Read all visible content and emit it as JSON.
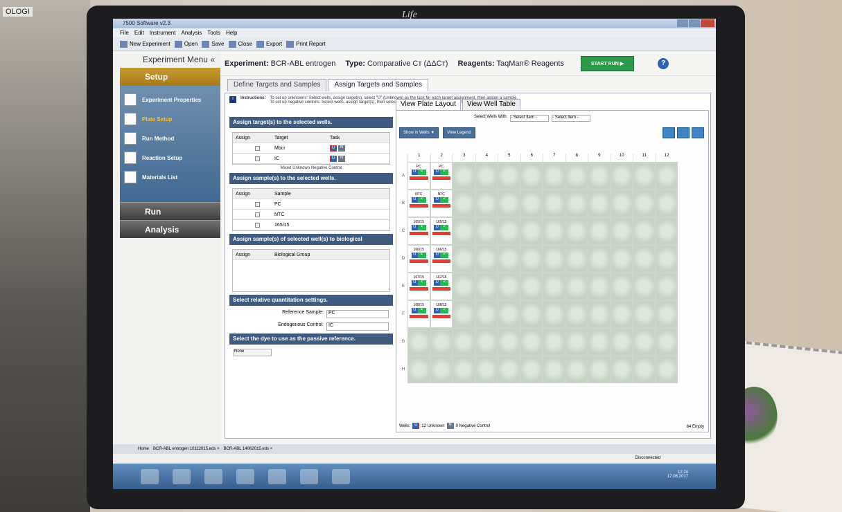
{
  "window": {
    "title": "7500 Software v2.3"
  },
  "menu": [
    "File",
    "Edit",
    "Instrument",
    "Analysis",
    "Tools",
    "Help"
  ],
  "toolbar": [
    "New Experiment",
    "Open",
    "Save",
    "Close",
    "Export",
    "Print Report"
  ],
  "sidebar": {
    "title": "Experiment Menu «",
    "setup": "Setup",
    "items": [
      "Experiment Properties",
      "Plate Setup",
      "Run Method",
      "Reaction Setup",
      "Materials List"
    ],
    "run": "Run",
    "analysis": "Analysis"
  },
  "experiment": {
    "label": "Experiment:",
    "name": "BCR-ABL entrogen",
    "type_label": "Type:",
    "type": "Comparative Cт (ΔΔCт)",
    "reagents_label": "Reagents:",
    "reagents": "TaqMan® Reagents",
    "start_run": "START RUN ▶",
    "help": "?"
  },
  "tabs": [
    "Define Targets and Samples",
    "Assign Targets and Samples"
  ],
  "instructions": {
    "label": "Instructions:",
    "line1": "To set up unknowns: Select wells, assign target(s), select \"U\" (Unknown) as the task for each target assignment, then assign a sample.",
    "line2": "To set up negative controls: Select wells, assign target(s), then select \"N\" (Negative Control) as the task for each target assignment."
  },
  "assign_targets": {
    "header": "Assign target(s) to the selected wells.",
    "columns": [
      "Assign",
      "Target",
      "Task"
    ],
    "rows": [
      {
        "target": "Mbcr"
      },
      {
        "target": "IC"
      }
    ],
    "legend": "Mixed  Unknown  Negative Control"
  },
  "assign_samples": {
    "header": "Assign sample(s) to the selected wells.",
    "columns": [
      "Assign",
      "Sample"
    ],
    "rows": [
      "PC",
      "NTC",
      "165/15"
    ]
  },
  "bio_groups": {
    "header": "Assign sample(s) of selected well(s) to biological",
    "columns": [
      "Assign",
      "Biological Group"
    ]
  },
  "rq": {
    "header": "Select relative quantitation settings.",
    "ref_label": "Reference Sample:",
    "ref_value": "PC",
    "endo_label": "Endogenous Control:",
    "endo_value": "IC"
  },
  "dye": {
    "header": "Select the dye to use as the passive reference.",
    "value": "None"
  },
  "plate_tabs": [
    "View Plate Layout",
    "View Well Table"
  ],
  "select_wells": {
    "label": "Select Wells With:",
    "opt1": "- Select Item -",
    "opt2": "- Select Item -"
  },
  "plate_buttons": {
    "show": "Show in Wells ▼",
    "legend": "View Legend"
  },
  "columns": [
    "1",
    "2",
    "3",
    "4",
    "5",
    "6",
    "7",
    "8",
    "9",
    "10",
    "11",
    "12"
  ],
  "rows": [
    "A",
    "B",
    "C",
    "D",
    "E",
    "F",
    "G",
    "H"
  ],
  "wells": [
    [
      "PC",
      "PC"
    ],
    [
      "NTC",
      "NTC"
    ],
    [
      "165/15",
      "165/15"
    ],
    [
      "166/15",
      "166/15"
    ],
    [
      "167/15",
      "167/15"
    ],
    [
      "168/15",
      "168/15"
    ]
  ],
  "plate_footer": {
    "wells_label": "Wells:",
    "unknown": "12 Unknown",
    "neg": "0 Negative Control",
    "empty": "84 Empty"
  },
  "bottom_tabs": [
    "Home",
    "BCR-ABL entrogen 10112015.eds ×",
    "BCR-ABL 14062015.eds ×"
  ],
  "status": "Disconnected",
  "clock": {
    "time": "12:24",
    "date": "17.06.2017"
  },
  "wall_label": "OLOGI",
  "brand": "Life"
}
